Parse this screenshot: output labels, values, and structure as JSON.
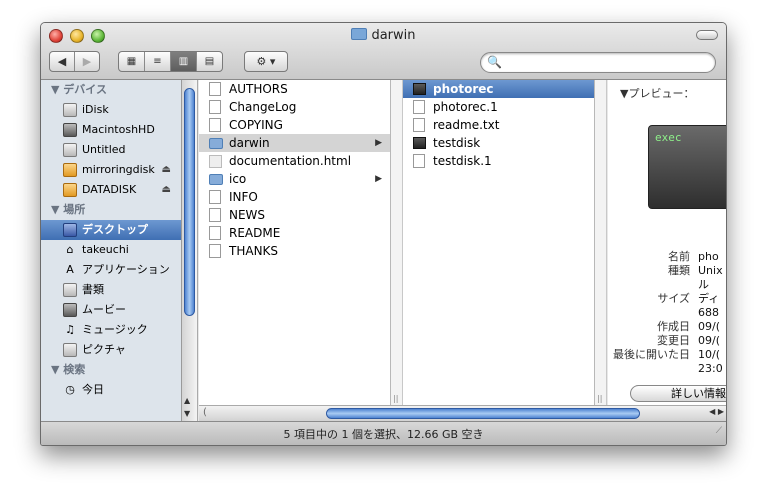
{
  "window": {
    "title": "darwin"
  },
  "toolbar": {
    "back_label": "◀",
    "forward_label": "▶",
    "views": [
      "▦",
      "≡",
      "▥",
      "▤"
    ],
    "gear_label": "⚙ ▾",
    "search": {
      "placeholder": "",
      "icon": "search-icon"
    }
  },
  "sidebar": {
    "devices_header": "▼ デバイス",
    "devices": [
      {
        "label": "iDisk",
        "icon": "idisk-icon"
      },
      {
        "label": "MacintoshHD",
        "icon": "harddisk-icon"
      },
      {
        "label": "Untitled",
        "icon": "disk-icon"
      },
      {
        "label": "mirroringdisk",
        "icon": "disk-image-icon",
        "eject": "⏏"
      },
      {
        "label": "DATADISK",
        "icon": "disk-image-icon",
        "eject": "⏏"
      }
    ],
    "places_header": "▼ 場所",
    "places": [
      {
        "label": "デスクトップ",
        "icon": "desktop-icon",
        "selected": true
      },
      {
        "label": "takeuchi",
        "icon": "home-icon"
      },
      {
        "label": "アプリケーション",
        "icon": "applications-icon"
      },
      {
        "label": "書類",
        "icon": "documents-icon"
      },
      {
        "label": "ムービー",
        "icon": "movies-icon"
      },
      {
        "label": "ミュージック",
        "icon": "music-icon"
      },
      {
        "label": "ピクチャ",
        "icon": "pictures-icon"
      }
    ],
    "search_header": "▼ 検索",
    "search_items": [
      {
        "label": "今日",
        "icon": "clock-icon"
      }
    ]
  },
  "column1": [
    {
      "label": "AUTHORS",
      "type": "file"
    },
    {
      "label": "ChangeLog",
      "type": "file"
    },
    {
      "label": "COPYING",
      "type": "file"
    },
    {
      "label": "darwin",
      "type": "folder",
      "selected": true,
      "arrow": "▶"
    },
    {
      "label": "documentation.html",
      "type": "html"
    },
    {
      "label": "ico",
      "type": "folder",
      "arrow": "▶"
    },
    {
      "label": "INFO",
      "type": "file"
    },
    {
      "label": "NEWS",
      "type": "file"
    },
    {
      "label": "README",
      "type": "file"
    },
    {
      "label": "THANKS",
      "type": "file"
    }
  ],
  "column2": [
    {
      "label": "photorec",
      "type": "exec",
      "selected": true
    },
    {
      "label": "photorec.1",
      "type": "file"
    },
    {
      "label": "readme.txt",
      "type": "file"
    },
    {
      "label": "testdisk",
      "type": "exec"
    },
    {
      "label": "testdisk.1",
      "type": "file"
    }
  ],
  "preview": {
    "header": "▼プレビュー：",
    "thumb_text": "exec",
    "info": [
      {
        "k": "名前",
        "v": "pho"
      },
      {
        "k": "種類",
        "v": "Unix"
      },
      {
        "k": "",
        "v": "ル"
      },
      {
        "k": "サイズ",
        "v": "ディ"
      },
      {
        "k": "",
        "v": "688"
      },
      {
        "k": "作成日",
        "v": "09/("
      },
      {
        "k": "変更日",
        "v": "09/("
      },
      {
        "k": "最後に開いた日",
        "v": "10/("
      },
      {
        "k": "",
        "v": "23:0"
      }
    ],
    "more_label": "詳しい情報"
  },
  "status": {
    "text": "5 項目中の 1 個を選択、12.66 GB 空き"
  }
}
